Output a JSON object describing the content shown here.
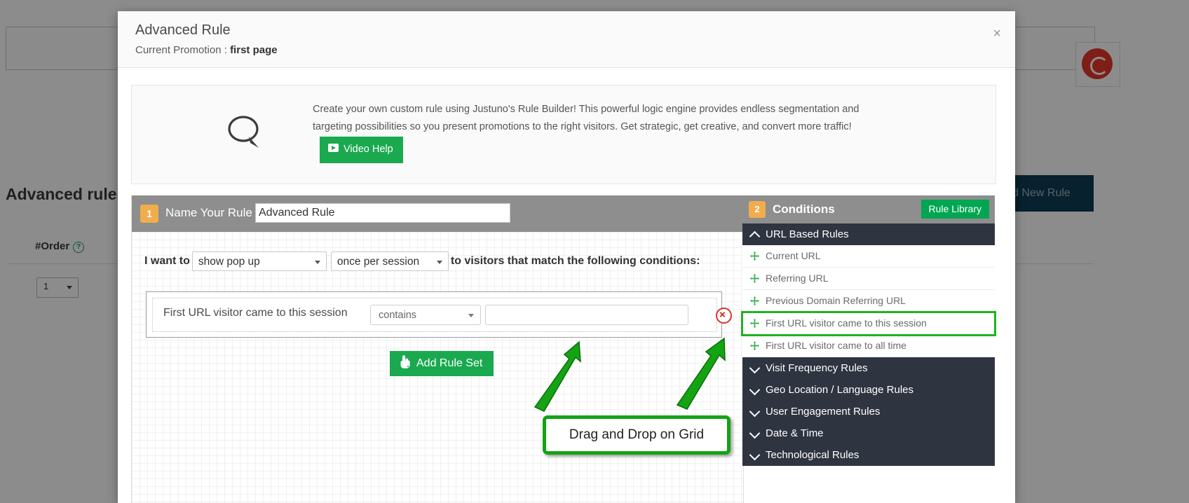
{
  "background": {
    "section_title": "Advanced rules",
    "order_header": "#Order",
    "order_value": "1",
    "add_new_rule_label": "dd New Rule"
  },
  "modal": {
    "title": "Advanced Rule",
    "subtitle_label": "Current Promotion :",
    "subtitle_value": "first page",
    "close_label": "×"
  },
  "info": {
    "text": "Create your own custom rule using Justuno's Rule Builder!   This powerful logic engine provides endless segmentation and targeting possibilities so you present promotions to the right visitors. Get strategic, get creative, and convert more traffic!",
    "video_help_label": "Video Help",
    "icon": "speech-bubble-icon"
  },
  "builder": {
    "step_number": "1",
    "step_label": "Name Your Rule",
    "rule_name_value": "Advanced Rule",
    "sentence_prefix": "I want to",
    "action_select": "show pop up",
    "frequency_select": "once per session",
    "sentence_suffix": "to visitors that match the following conditions:",
    "rule_row": {
      "label": "First URL visitor came to this session",
      "operator": "contains",
      "value": "",
      "delete_title": "remove-rule"
    },
    "add_rule_set_label": "Add Rule Set"
  },
  "conditions": {
    "step_number": "2",
    "title": "Conditions",
    "rule_library_label": "Rule Library",
    "groups": [
      {
        "label": "URL Based Rules",
        "expanded": true,
        "items": [
          {
            "label": "Current URL",
            "highlighted": false
          },
          {
            "label": "Referring URL",
            "highlighted": false
          },
          {
            "label": "Previous Domain Referring URL",
            "highlighted": false
          },
          {
            "label": "First URL visitor came to this session",
            "highlighted": true
          },
          {
            "label": "First URL visitor came to all time",
            "highlighted": false
          }
        ]
      },
      {
        "label": "Visit Frequency Rules",
        "expanded": false,
        "items": []
      },
      {
        "label": "Geo Location / Language Rules",
        "expanded": false,
        "items": []
      },
      {
        "label": "User Engagement Rules",
        "expanded": false,
        "items": []
      },
      {
        "label": "Date & Time",
        "expanded": false,
        "items": []
      },
      {
        "label": "Technological Rules",
        "expanded": false,
        "items": []
      }
    ]
  },
  "annotation": {
    "callout_text": "Drag and Drop on Grid",
    "color": "#13a313"
  },
  "colors": {
    "accent_green": "#1aa94f",
    "library_green": "#00a651",
    "badge_orange": "#f0ac4d",
    "header_gray": "#8e8e8e",
    "group_dark": "#2f3441",
    "annotation_green": "#13a313",
    "delete_red": "#d9352a"
  }
}
